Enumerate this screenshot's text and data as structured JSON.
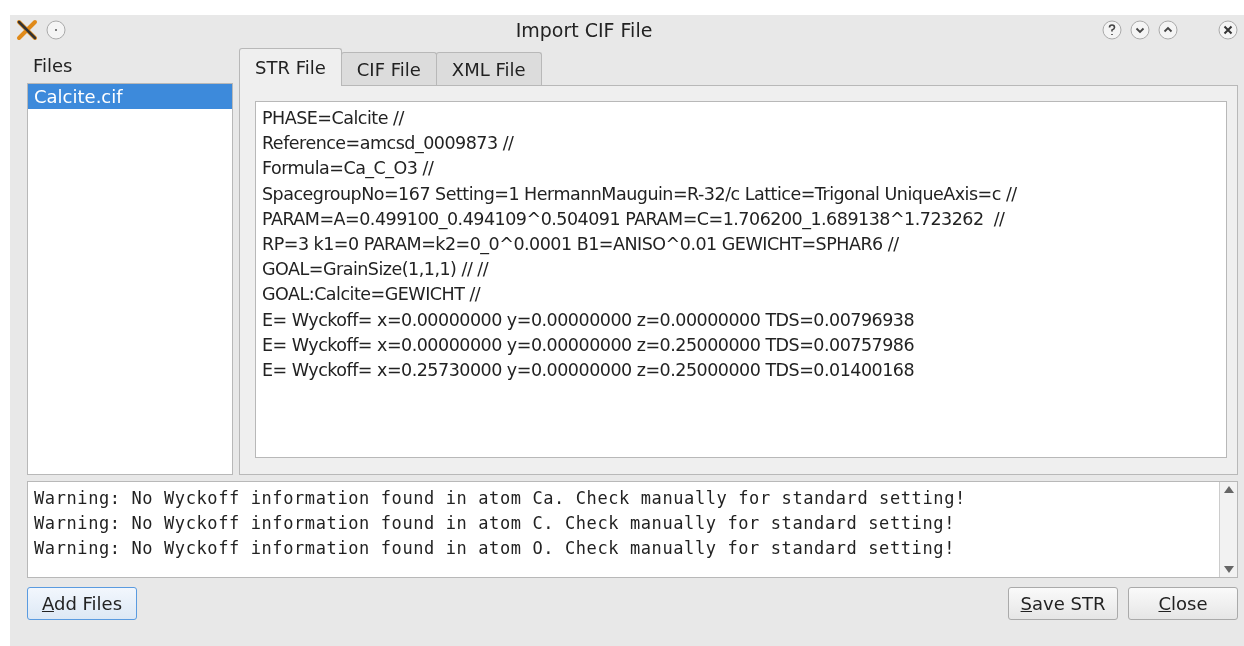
{
  "window": {
    "title": "Import CIF File"
  },
  "files": {
    "label": "Files",
    "items": [
      {
        "name": "Calcite.cif",
        "selected": true
      }
    ]
  },
  "tabs": [
    {
      "label": "STR File",
      "selected": true
    },
    {
      "label": "CIF File",
      "selected": false
    },
    {
      "label": "XML File",
      "selected": false
    }
  ],
  "editor_lines": [
    "PHASE=Calcite //",
    "Reference=amcsd_0009873 //",
    "Formula=Ca_C_O3 //",
    "SpacegroupNo=167 Setting=1 HermannMauguin=R-32/c Lattice=Trigonal UniqueAxis=c //",
    "PARAM=A=0.499100_0.494109^0.504091 PARAM=C=1.706200_1.689138^1.723262  //",
    "RP=3 k1=0 PARAM=k2=0_0^0.0001 B1=ANISO^0.01 GEWICHT=SPHAR6 //",
    "GOAL=GrainSize(1,1,1) // //",
    "GOAL:Calcite=GEWICHT //",
    "E= Wyckoff= x=0.00000000 y=0.00000000 z=0.00000000 TDS=0.00796938",
    "E= Wyckoff= x=0.00000000 y=0.00000000 z=0.25000000 TDS=0.00757986",
    "E= Wyckoff= x=0.25730000 y=0.00000000 z=0.25000000 TDS=0.01400168"
  ],
  "log_lines": [
    "Warning: No Wyckoff information found in atom Ca. Check manually for standard setting!",
    "Warning: No Wyckoff information found in atom C. Check manually for standard setting!",
    "Warning: No Wyckoff information found in atom O. Check manually for standard setting!"
  ],
  "buttons": [
    {
      "label": "Add Files",
      "kind": "left",
      "focused": true
    },
    {
      "label": "Save STR",
      "kind": "right",
      "focused": false
    },
    {
      "label": "Close",
      "kind": "right",
      "focused": false
    }
  ]
}
